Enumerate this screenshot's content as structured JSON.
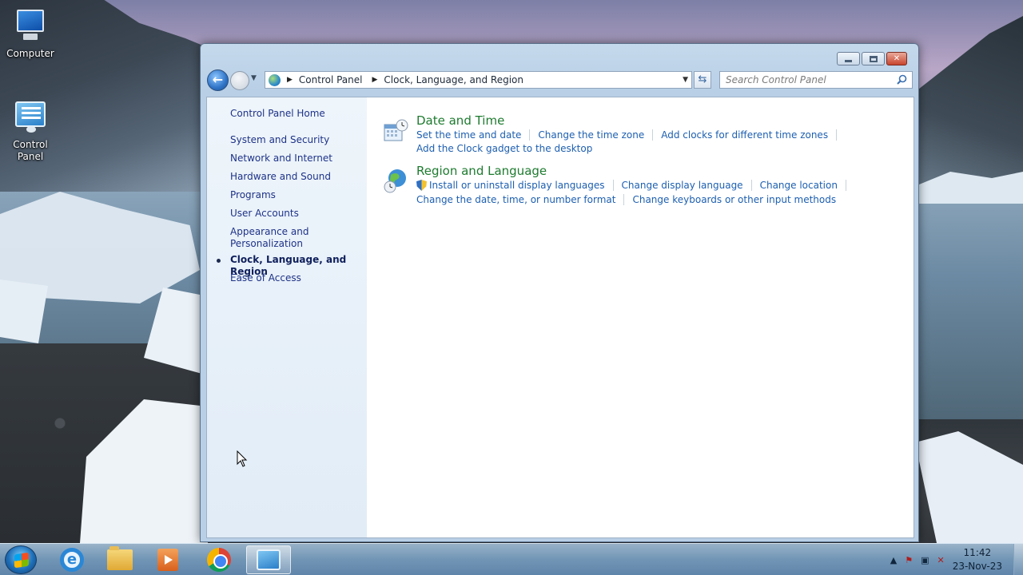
{
  "desktop": {
    "icons": [
      {
        "label": "Computer"
      },
      {
        "label": "Control\nPanel"
      }
    ]
  },
  "window": {
    "address": {
      "crumbs": [
        "Control Panel",
        "Clock, Language, and Region"
      ]
    },
    "search": {
      "placeholder": "Search Control Panel"
    }
  },
  "sidebar": {
    "home": "Control Panel Home",
    "items": [
      {
        "label": "System and Security"
      },
      {
        "label": "Network and Internet"
      },
      {
        "label": "Hardware and Sound"
      },
      {
        "label": "Programs"
      },
      {
        "label": "User Accounts"
      },
      {
        "label": "Appearance and Personalization"
      },
      {
        "label": "Clock, Language, and Region",
        "active": true
      },
      {
        "label": "Ease of Access"
      }
    ]
  },
  "categories": [
    {
      "title": "Date and Time",
      "links_row1": [
        "Set the time and date",
        "Change the time zone",
        "Add clocks for different time zones"
      ],
      "links_row2": [
        "Add the Clock gadget to the desktop"
      ]
    },
    {
      "title": "Region and Language",
      "links_row1": [
        "Install or uninstall display languages",
        "Change display language",
        "Change location"
      ],
      "links_row2": [
        "Change the date, time, or number format",
        "Change keyboards or other input methods"
      ]
    }
  ],
  "taskbar": {
    "time": "11:42",
    "date": "23-Nov-23"
  },
  "colors": {
    "link": "#1d5fb0",
    "category_title": "#1e7b2f",
    "sidebar_link": "#1e3287"
  }
}
